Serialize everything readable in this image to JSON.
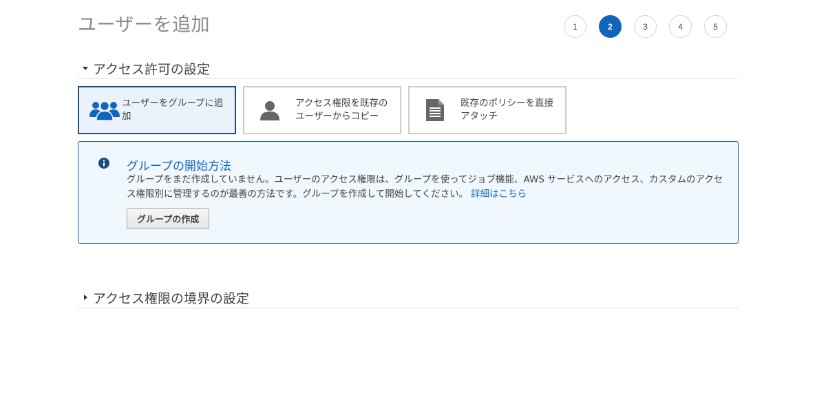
{
  "page": {
    "title": "ユーザーを追加"
  },
  "steps": [
    "1",
    "2",
    "3",
    "4",
    "5"
  ],
  "current_step": 2,
  "permissions_section": {
    "title": "アクセス許可の設定",
    "expanded": true,
    "options": [
      {
        "label": "ユーザーをグループに追加",
        "icon": "users-group-icon",
        "selected": true
      },
      {
        "label": "アクセス権限を既存のユーザーからコピー",
        "icon": "user-icon",
        "selected": false
      },
      {
        "label": "既存のポリシーを直接アタッチ",
        "icon": "document-icon",
        "selected": false
      }
    ]
  },
  "info_box": {
    "icon": "info-icon",
    "title": "グループの開始方法",
    "body": "グループをまだ作成していません。ユーザーのアクセス権限は、グループを使ってジョブ機能、AWS サービスへのアクセス、カスタムのアクセス権限別に管理するのが最善の方法です。グループを作成して開始してください。",
    "link": "詳細はこちら",
    "button": "グループの作成"
  },
  "boundary_section": {
    "title": "アクセス権限の境界の設定",
    "expanded": false
  },
  "colors": {
    "accent": "#1166bb",
    "selected_border": "#1b4d7e",
    "selected_bg": "#eaf3fc",
    "info_bg": "#f0f7fd",
    "title_gray": "#8a8a8a"
  }
}
